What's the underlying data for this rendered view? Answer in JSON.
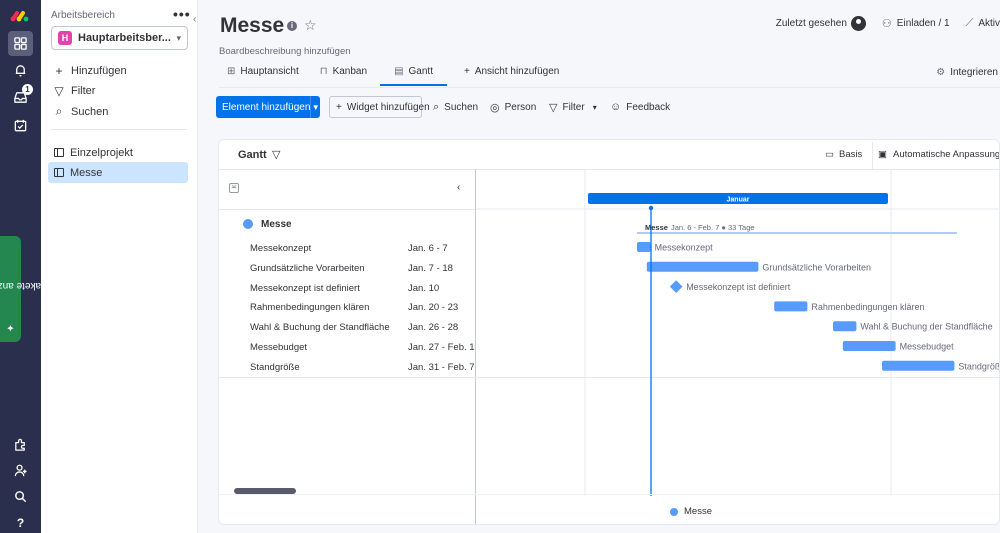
{
  "rail": {
    "pakete_label": "Pakete anzeigen",
    "inbox_count": "1",
    "icons": [
      "monday-logo-icon",
      "grid-icon",
      "bell-icon",
      "inbox-icon",
      "calendar-check-icon",
      "puzzle-icon",
      "person-add-icon",
      "search-icon",
      "help-icon"
    ]
  },
  "workspace": {
    "title": "Arbeitsbereich",
    "avatar_letter": "H",
    "name": "Hauptarbeitsber...",
    "actions": [
      {
        "label": "Hinzufügen",
        "icon": "plus-icon"
      },
      {
        "label": "Filter",
        "icon": "filter-icon"
      },
      {
        "label": "Suchen",
        "icon": "search-icon"
      }
    ],
    "boards": [
      {
        "label": "Einzelprojekt",
        "selected": false
      },
      {
        "label": "Messe",
        "selected": true
      }
    ]
  },
  "board": {
    "title": "Messe",
    "description": "Boardbeschreibung hinzufügen",
    "zuletzt_gesehen": "Zuletzt gesehen",
    "einladen": "Einladen / 1",
    "aktiv": "Aktiv",
    "integrieren": "Integrieren"
  },
  "tabs": [
    {
      "label": "Hauptansicht",
      "icon": "table-icon",
      "active": false
    },
    {
      "label": "Kanban",
      "icon": "kanban-icon",
      "active": false
    },
    {
      "label": "Gantt",
      "icon": "gantt-icon",
      "active": true
    },
    {
      "label": "Ansicht hinzufügen",
      "icon": "plus-icon",
      "active": false
    }
  ],
  "toolbar": {
    "add_element": "Element hinzufügen",
    "add_widget": "Widget hinzufügen",
    "search": "Suchen",
    "person": "Person",
    "filter": "Filter",
    "feedback": "Feedback"
  },
  "gantt": {
    "title": "Gantt",
    "basis": "Basis",
    "auto_fit": "Automatische Anpassung",
    "month": "Januar",
    "group": {
      "name": "Messe",
      "summary_name": "Messe",
      "summary_range": "Jan. 6 - Feb. 7 ● 33 Tage",
      "color": "#579bfc"
    },
    "legend_label": "Messe",
    "colors": {
      "bar": "#579bfc",
      "month": "#0073ea",
      "today": "#0073ea"
    },
    "rows": [
      {
        "name": "Messekonzept",
        "date": "Jan. 6 - 7",
        "start": 6,
        "end": 7,
        "milestone": false
      },
      {
        "name": "Grundsätzliche Vorarbeiten",
        "date": "Jan. 7 - 18",
        "start": 7,
        "end": 18,
        "milestone": false
      },
      {
        "name": "Messekonzept ist definiert",
        "date": "Jan. 10",
        "start": 10,
        "end": 10,
        "milestone": true
      },
      {
        "name": "Rahmenbedingungen klären",
        "date": "Jan. 20 - 23",
        "start": 20,
        "end": 23,
        "milestone": false
      },
      {
        "name": "Wahl & Buchung der Standfläche",
        "date": "Jan. 26 - 28",
        "start": 26,
        "end": 28,
        "milestone": false
      },
      {
        "name": "Messebudget",
        "date": "Jan. 27 - Feb. 1",
        "start": 27,
        "end": 32,
        "milestone": false
      },
      {
        "name": "Standgröße",
        "date": "Jan. 31 - Feb. 7",
        "start": 31,
        "end": 38,
        "milestone": false
      }
    ]
  }
}
